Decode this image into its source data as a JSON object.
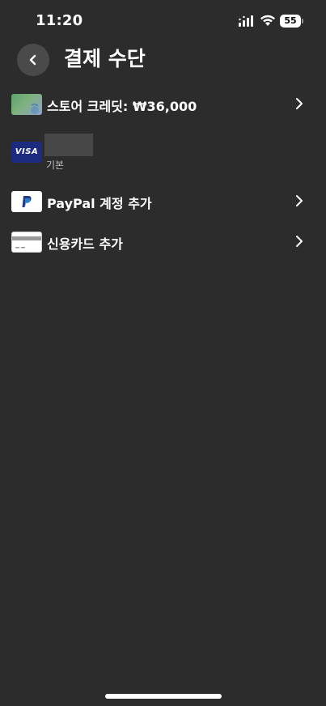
{
  "status_bar": {
    "time": "11:20",
    "battery_level": "55"
  },
  "header": {
    "title": "결제 수단"
  },
  "payment_methods": {
    "store_credit": {
      "label": "스토어 크레딧: ₩36,000",
      "icon": "gift-card-icon"
    },
    "visa": {
      "brand_text": "VISA",
      "default_label": "기본",
      "icon": "visa-card-icon"
    },
    "paypal": {
      "label": "PayPal 계정 추가",
      "icon": "paypal-icon"
    },
    "credit_card": {
      "label": "신용카드 추가",
      "icon": "credit-card-icon"
    }
  },
  "colors": {
    "background": "#2c2c2c",
    "back_button": "#4a4a4a",
    "visa_brand": "#1c2a80"
  }
}
